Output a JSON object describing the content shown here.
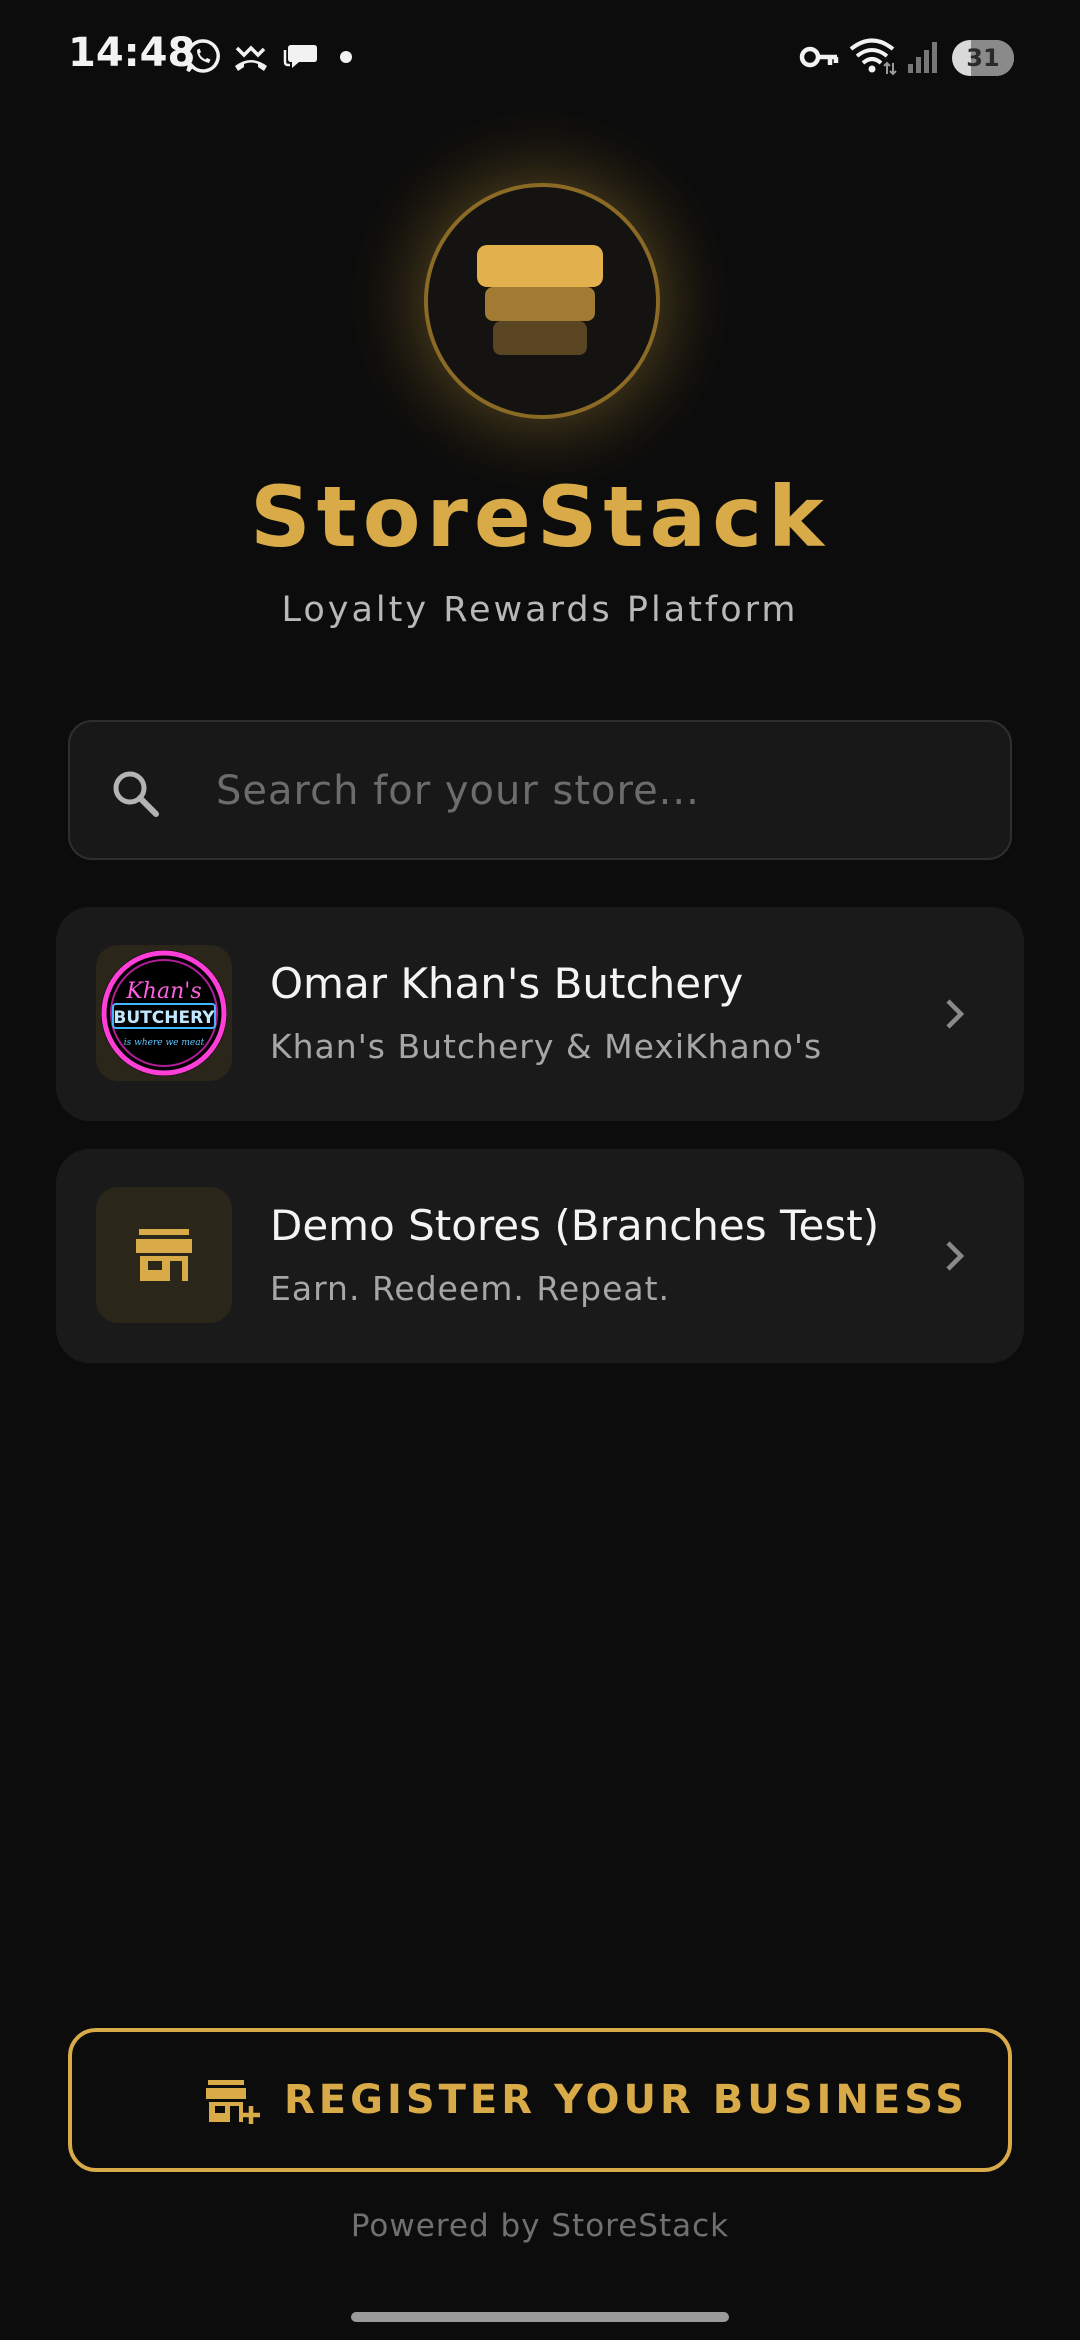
{
  "status_bar": {
    "time": "14:48",
    "battery_level": "31",
    "battery_fraction": 0.31,
    "notification_icons": [
      "whatsapp-icon",
      "missed-call-icon",
      "chat-bubble-icon",
      "dot-icon"
    ],
    "system_icons": [
      "vpn-key-icon",
      "wifi-icon",
      "cell-signal-icon",
      "battery-icon"
    ]
  },
  "brand": {
    "title": "StoreStack",
    "subtitle": "Loyalty Rewards Platform",
    "accent_color": "#d8aa48",
    "logo_icon": "stacked-layers-icon"
  },
  "search": {
    "placeholder": "Search for your store...",
    "value": "",
    "icon": "search-icon"
  },
  "stores": [
    {
      "name": "Omar Khan's Butchery",
      "tagline": "Khan's Butchery & MexiKhano's",
      "logo": {
        "script_text": "Khan's",
        "main_text": "BUTCHERY",
        "small_text": "is where we meat"
      }
    },
    {
      "name": "Demo Stores (Branches Test)",
      "tagline": "Earn. Redeem. Repeat.",
      "icon": "storefront-icon"
    }
  ],
  "register": {
    "label": "REGISTER YOUR BUSINESS",
    "icon": "add-business-icon"
  },
  "footer": {
    "powered_by": "Powered by StoreStack"
  }
}
